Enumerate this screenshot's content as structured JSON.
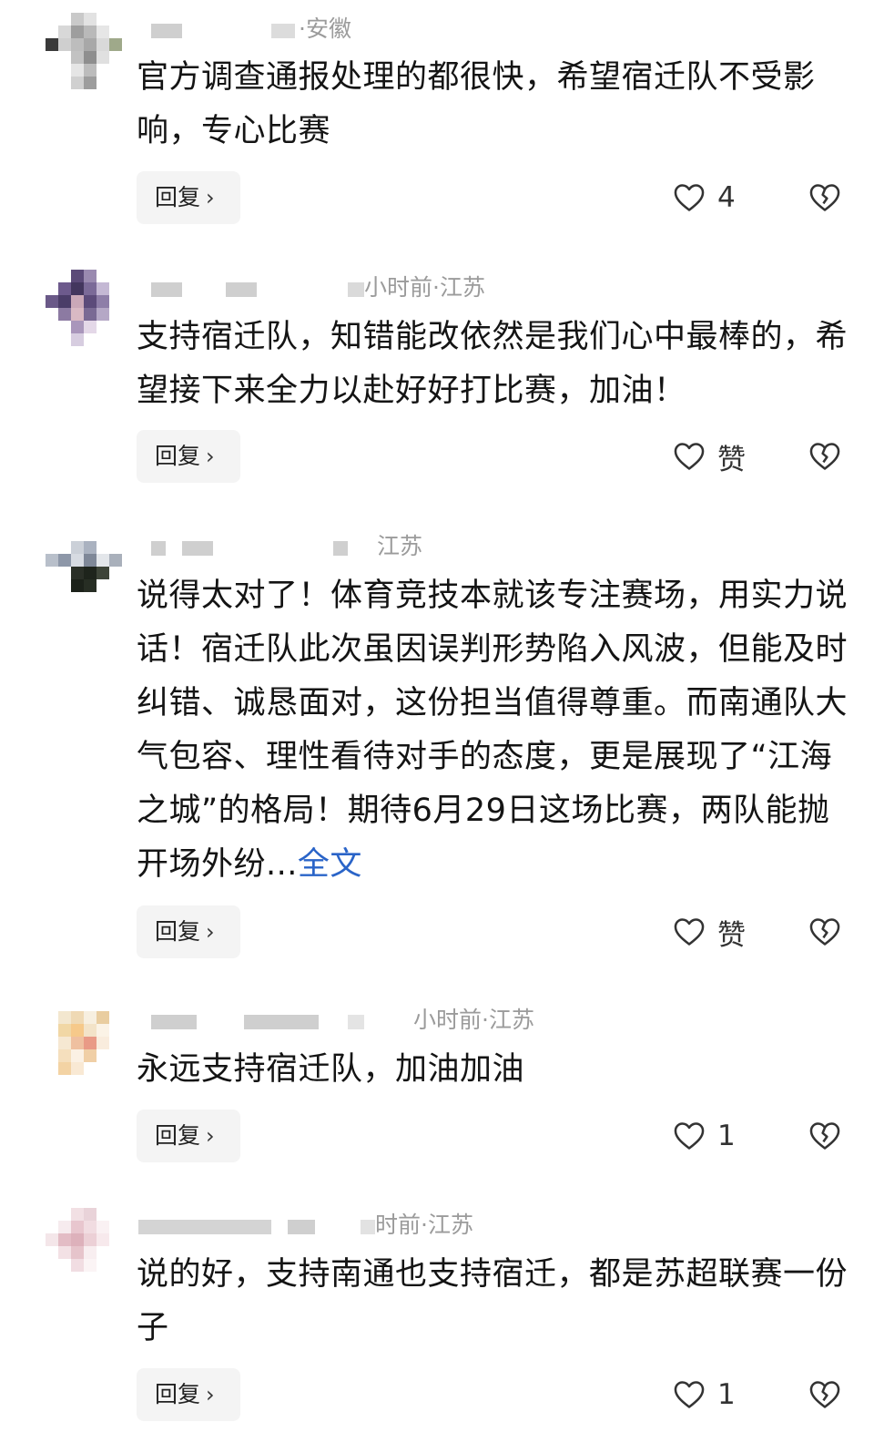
{
  "comments": [
    {
      "meta": "·安徽",
      "text": "官方调查通报处理的都很快，希望宿迁队不受影响，专心比赛",
      "more": "",
      "reply_label": "回复",
      "like_count": "4"
    },
    {
      "meta": "小时前·江苏",
      "text": "支持宿迁队，知错能改依然是我们心中最棒的，希望接下来全力以赴好好打比赛，加油！",
      "more": "",
      "reply_label": "回复",
      "like_count": "赞"
    },
    {
      "meta": "江苏",
      "text": "说得太对了！体育竞技本就该专注赛场，用实力说话！宿迁队此次虽因误判形势陷入风波，但能及时纠错、诚恳面对，这份担当值得尊重。而南通队大气包容、理性看待对手的态度，更是展现了“江海之城”的格局！期待6月29日这场比赛，两队能抛开场外纷...",
      "more": "全文",
      "reply_label": "回复",
      "like_count": "赞"
    },
    {
      "meta": "小时前·江苏",
      "text": "永远支持宿迁队，加油加油",
      "more": "",
      "reply_label": "回复",
      "like_count": "1"
    },
    {
      "meta": "时前·江苏",
      "text": "说的好，支持南通也支持宿迁，都是苏超联赛一份子",
      "more": "",
      "reply_label": "回复",
      "like_count": "1"
    }
  ],
  "icons": {
    "like": "heart-outline-icon",
    "dislike": "broken-heart-icon",
    "chevron": "chevron-right-icon"
  },
  "colors": {
    "text": "#141414",
    "meta": "#9b9b9b",
    "link": "#2a64c8",
    "reply_bg": "#f4f4f4"
  }
}
